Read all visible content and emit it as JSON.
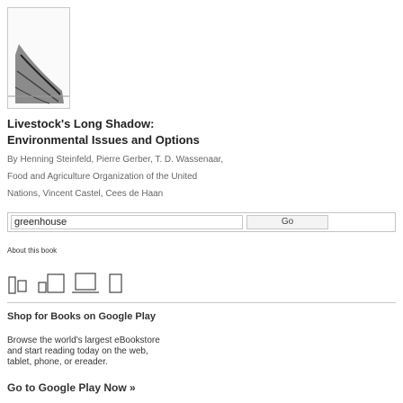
{
  "book": {
    "title_line1": "Livestock's Long Shadow:",
    "title_line2": "Environmental Issues and Options",
    "authors_line1": "By Henning Steinfeld, Pierre Gerber, T. D. Wassenaar,",
    "authors_line2": "Food and Agriculture Organization of the United",
    "authors_line3": "Nations, Vincent Castel, Cees de Haan"
  },
  "search": {
    "value": "greenhouse",
    "button_label": "Go"
  },
  "about_link": "About this book",
  "store_icons": [
    "phone-icon",
    "tablet-icon",
    "laptop-icon",
    "ereader-icon"
  ],
  "shop": {
    "heading": "Shop for Books on Google Play",
    "desc_line1": "Browse the world's largest eBookstore",
    "desc_line2": "and start reading today on the web,",
    "desc_line3": "tablet, phone, or ereader.",
    "cta": "Go to Google Play Now »"
  },
  "colors": {
    "border": "#c8c8c8",
    "text": "#222222",
    "muted": "#666666"
  }
}
